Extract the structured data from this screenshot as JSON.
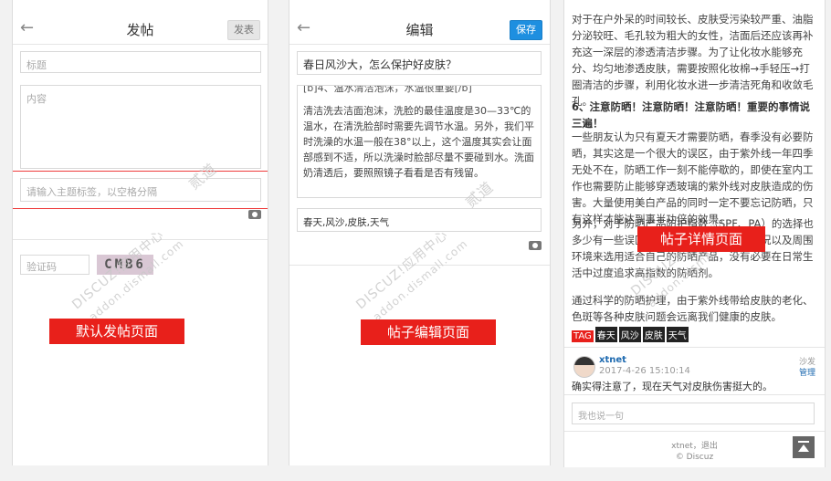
{
  "panel1": {
    "header": {
      "title": "发帖",
      "button": "发表"
    },
    "title_placeholder": "标题",
    "content_placeholder": "内容",
    "tag_placeholder": "请输入主题标签，以空格分隔",
    "captcha_placeholder": "验证码",
    "captcha_image_text": "CMB6",
    "label": "默认发帖页面"
  },
  "panel2": {
    "header": {
      "title": "编辑",
      "button": "保存"
    },
    "post_title": "春日风沙大，怎么保护好皮肤？",
    "content_top": "[b]4、温水清洁泡沫，水温很重要[/b]",
    "content_body": "清洁洗去洁面泡沫，洗脸的最佳温度是30—33℃的温水，在清洗脸部时需要先调节水温。另外，我们平时洗澡的水温一般在38°以上，这个温度其实会让面部感到不适，所以洗澡时脸部尽量不要碰到水。洗面奶清透后，要照照镜子看看是否有残留。",
    "tags_value": "春天,风沙,皮肤,天气",
    "label": "帖子编辑页面"
  },
  "panel3": {
    "para1": "对于在户外呆的时间较长、皮肤受污染较严重、油脂分泌较旺、毛孔较为粗大的女性，洁面后还应该再补充这一深层的渗透清洁步骤。为了让化妆水能够充分、均匀地渗透皮肤，需要按照化妆棉→手轻压→打圈清洁的步骤，利用化妆水进一步清洁死角和收敛毛孔。",
    "heading": "6、注意防晒！注意防晒！注意防晒！重要的事情说三遍！",
    "para2": "一些朋友认为只有夏天才需要防晒，春季没有必要防晒，其实这是一个很大的误区，由于紫外线一年四季无处不在，防晒工作一刻不能停歇的，即使在室内工作也需要防止能够穿透玻璃的紫外线对皮肤造成的伤害。大量使用美白产品的同时一定不要忘记防晒，只有这样才能达到事半功倍的效果。",
    "para3": "另外，对于防晒产品防护指数（SPF、PA）的选择也多少有一些误区，建议根据自己的皮肤情况以及周围环境来选用适合自己的防晒产品，没有必要在日常生活中过度追求高指数的防晒剂。",
    "para4": "通过科学的防晒护理，由于紫外线带给皮肤的老化、色斑等各种皮肤问题会远离我们健康的皮肤。",
    "tags": {
      "tag_label": "TAG",
      "t1": "春天",
      "t2": "风沙",
      "t3": "皮肤",
      "t4": "天气"
    },
    "comment": {
      "user": "xtnet",
      "time": "2017-4-26 15:10:14",
      "floor": "沙发",
      "manage": "管理",
      "text": "确实得注意了，现在天气对皮肤伤害挺大的。"
    },
    "reply_placeholder": "我也说一句",
    "footer_user": "xtnet",
    "footer_sep": "，",
    "footer_logout": "退出",
    "footer_copy": "© Discuz",
    "label": "帖子详情页面"
  },
  "watermark": {
    "brand": "DISCUZ!应用中心",
    "site": "addon.dismall.com",
    "author": "贰道"
  }
}
